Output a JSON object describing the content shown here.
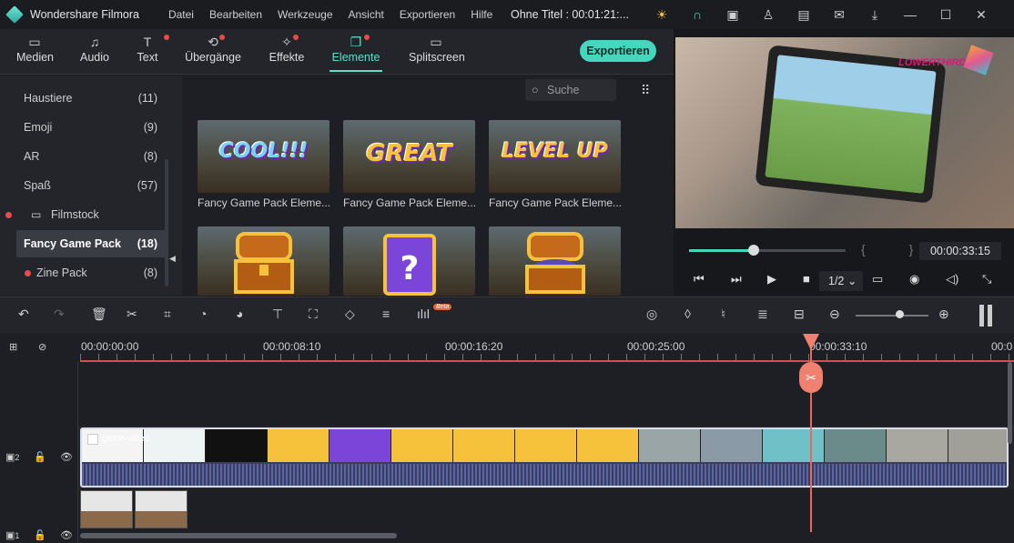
{
  "app": {
    "title": "Wondershare Filmora",
    "document": "Ohne Titel : 00:01:21:..."
  },
  "menu": [
    "Datei",
    "Bearbeiten",
    "Werkzeuge",
    "Ansicht",
    "Exportieren",
    "Hilfe"
  ],
  "library_tabs": [
    {
      "label": "Medien",
      "icon": "folder-icon"
    },
    {
      "label": "Audio",
      "icon": "music-note-icon"
    },
    {
      "label": "Text",
      "icon": "text-icon"
    },
    {
      "label": "Übergänge",
      "icon": "transition-icon"
    },
    {
      "label": "Effekte",
      "icon": "effects-icon"
    },
    {
      "label": "Elemente",
      "icon": "elements-icon"
    },
    {
      "label": "Splitscreen",
      "icon": "splitscreen-icon"
    }
  ],
  "export_label": "Exportieren",
  "sidebar": {
    "items": [
      {
        "label": "Haustiere",
        "count": "(11)"
      },
      {
        "label": "Emoji",
        "count": "(9)"
      },
      {
        "label": "AR",
        "count": "(8)"
      },
      {
        "label": "Spaß",
        "count": "(57)"
      },
      {
        "label": "Filmstock",
        "count": ""
      },
      {
        "label": "Fancy Game Pack",
        "count": "(18)"
      },
      {
        "label": "Zine Pack",
        "count": "(8)"
      }
    ]
  },
  "search": {
    "placeholder": "Suche"
  },
  "elements": [
    {
      "word": "COOL!!!",
      "label": "Fancy Game Pack Eleme..."
    },
    {
      "word": "GREAT",
      "label": "Fancy Game Pack Eleme..."
    },
    {
      "word": "LEVEL UP",
      "label": "Fancy Game Pack Eleme..."
    }
  ],
  "preview": {
    "overlay_text": "LOWERTHIRD",
    "timecode": "00:00:33:15",
    "ratio": "1/2",
    "braces": "{ }",
    "progress": 0.41
  },
  "timeline": {
    "ruler": [
      "00:00:00:00",
      "00:00:08:10",
      "00:00:16:20",
      "00:00:25:00",
      "00:00:33:10",
      "00:0"
    ],
    "clip_name": "game-video",
    "beta": "Beta",
    "track_labels": [
      "2",
      "1"
    ]
  }
}
